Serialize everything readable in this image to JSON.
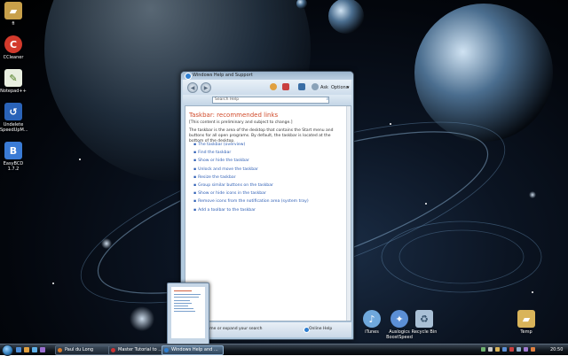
{
  "desktop_icons": [
    {
      "label": "fi",
      "icon": "folder-icon",
      "color": "#c8a04a"
    },
    {
      "label": "CCleaner",
      "icon": "ccleaner-icon",
      "color": "#d33a2c"
    },
    {
      "label": "Notepad++",
      "icon": "notepad-icon",
      "color": "#8bc34a"
    },
    {
      "label": "Undelete",
      "icon": "undelete-icon",
      "color": "#2a63b8"
    },
    {
      "label": "SpeedUpM...",
      "icon": "",
      "color": ""
    },
    {
      "label": "EasyBCD",
      "icon": "easybcd-icon",
      "color": "#3a7bd5"
    },
    {
      "label": "1.7.2",
      "icon": "",
      "color": ""
    }
  ],
  "right_icons": [
    {
      "label": "iTunes",
      "icon": "itunes-icon",
      "color": "#6fa8dc"
    },
    {
      "label": "Auslogics",
      "icon": "auslogics-icon",
      "color": "#5b8fd6"
    },
    {
      "label": "BoostSpeed",
      "icon": "",
      "color": ""
    },
    {
      "label": "Recycle Bin",
      "icon": "recycle-bin-icon",
      "color": "#a9c0d6"
    },
    {
      "label": "Temp",
      "icon": "folder-icon",
      "color": "#d9b45a"
    }
  ],
  "help_window": {
    "title": "Windows Help and Support",
    "toolbar": {
      "ask": "Ask",
      "options": "Options"
    },
    "search_placeholder": "Search Help",
    "heading": "Taskbar: recommended links",
    "note": "[This content is preliminary and subject to change.]",
    "paragraph": "The taskbar is the area of the desktop that contains the Start menu and buttons for all open programs. By default, the taskbar is located at the bottom of the desktop.",
    "links": [
      "The taskbar (overview)",
      "Find the taskbar",
      "Show or hide the taskbar",
      "Unlock and move the taskbar",
      "Resize the taskbar",
      "Group similar buttons on the taskbar",
      "Show or hide icons in the taskbar",
      "Remove icons from the notification area (system tray)",
      "Add a toolbar to the taskbar"
    ],
    "status_left": "...me or expand your search",
    "status_right": "Online Help"
  },
  "taskbar": {
    "tasks": [
      {
        "label": "Paul du Long",
        "color": "#d87a2a",
        "active": false
      },
      {
        "label": "Master Tutorial to ...",
        "color": "#cc3333",
        "active": false
      },
      {
        "label": "Windows Help and ...",
        "color": "#2f7fd1",
        "active": true
      }
    ],
    "clock": "20:50"
  }
}
